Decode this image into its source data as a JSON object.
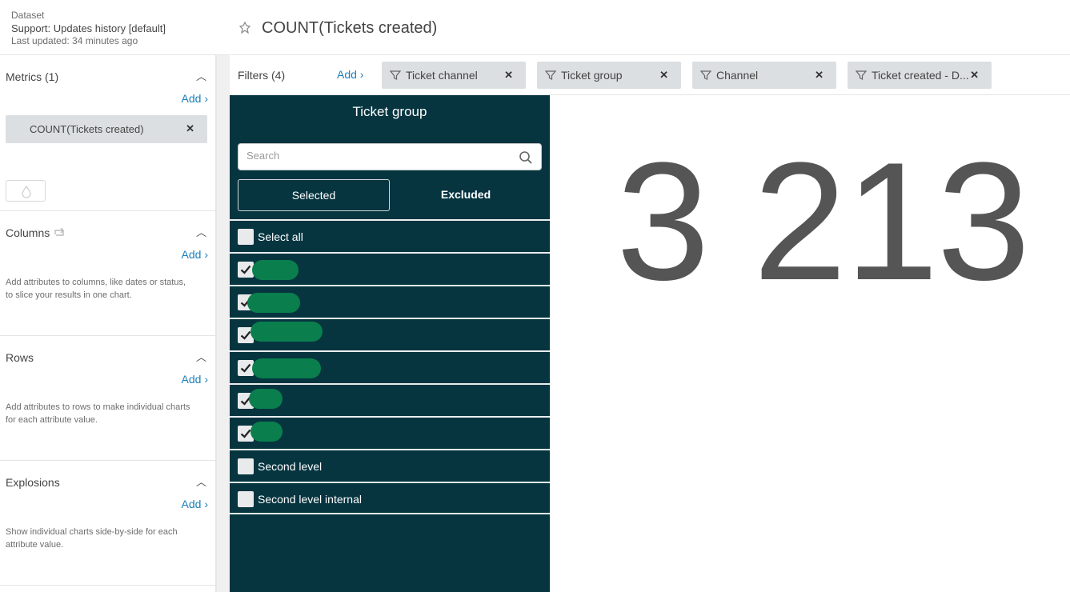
{
  "dataset": {
    "label": "Dataset",
    "name": "Support: Updates history [default]",
    "updated": "Last updated: 34 minutes ago"
  },
  "header": {
    "title": "COUNT(Tickets created)"
  },
  "sections": {
    "metrics": {
      "title": "Metrics (1)",
      "add": "Add ›",
      "pill": "COUNT(Tickets created)"
    },
    "columns": {
      "title": "Columns",
      "add": "Add ›",
      "desc": "Add attributes to columns, like dates or status, to slice your results in one chart."
    },
    "rows": {
      "title": "Rows",
      "add": "Add ›",
      "desc": "Add attributes to rows to make individual charts for each attribute value."
    },
    "explosions": {
      "title": "Explosions",
      "add": "Add ›",
      "desc": "Show individual charts side-by-side for each attribute value."
    }
  },
  "filters": {
    "label": "Filters (4)",
    "add": "Add ›",
    "chips": [
      "Ticket channel",
      "Ticket group",
      "Channel",
      "Ticket created - D..."
    ]
  },
  "panel": {
    "title": "Ticket group",
    "search_placeholder": "Search",
    "tab_selected": "Selected",
    "tab_excluded": "Excluded",
    "select_all": "Select all",
    "item_second_level": "Second level",
    "item_second_level_internal": "Second level internal"
  },
  "kpi": {
    "value": "3 213"
  },
  "colors": {
    "panel_bg": "#063540",
    "redaction": "#0a7f4d",
    "link": "#1a7fba"
  }
}
